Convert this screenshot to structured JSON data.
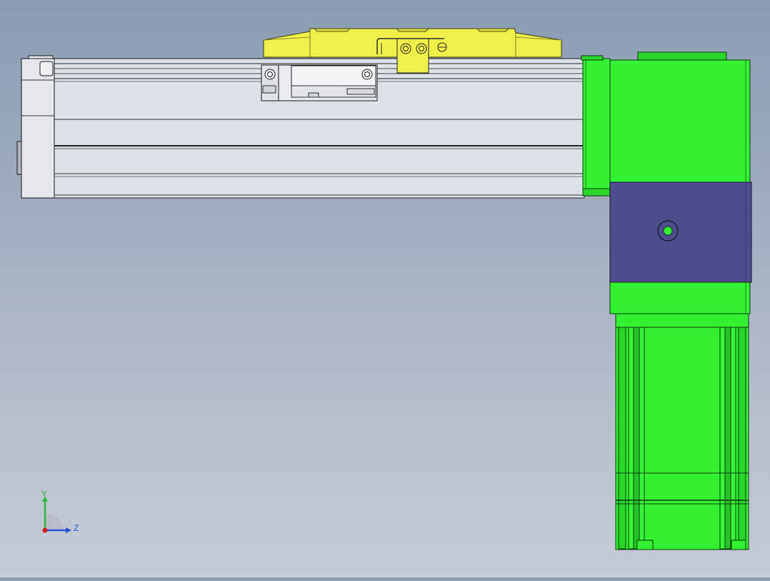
{
  "scene": {
    "view": "cad-3d-viewport",
    "colors": {
      "background_top": "#8b9cb3",
      "background_bottom": "#c6ccd6",
      "rail_body": "#dde2e8",
      "rail_edge": "#1a1a1a",
      "carriage_plate": "#f0f04a",
      "motor_body": "#33f033",
      "coupling_housing": "#4f4c8e"
    },
    "parts": {
      "rail": "linear-rail",
      "carriage": "slide-carriage",
      "bracket": "carriage-bracket",
      "motor": "stepper-motor",
      "housing": "coupling-housing",
      "shaft": "motor-shaft"
    }
  },
  "triad": {
    "y_label": "Y",
    "z_label": "Z",
    "colors": {
      "y": "#2fb83c",
      "z": "#2b4fd8",
      "origin": "#d02020"
    }
  }
}
